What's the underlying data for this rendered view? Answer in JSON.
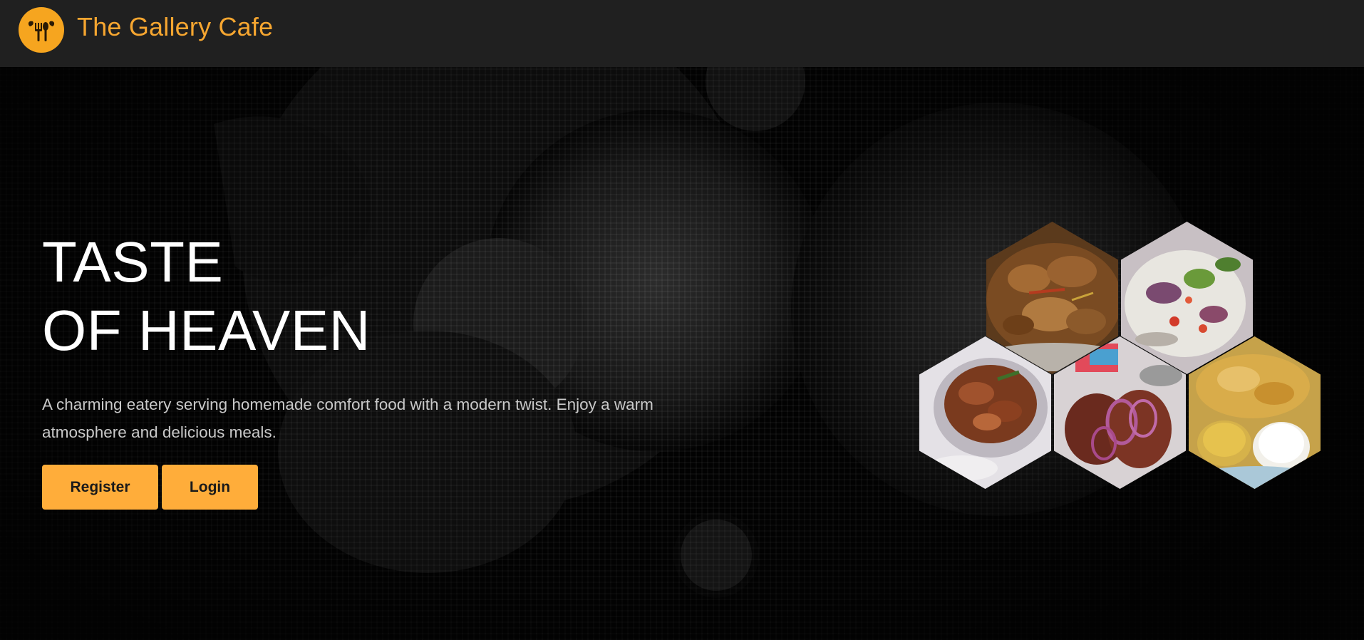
{
  "header": {
    "brand_name": "The Gallery Cafe",
    "logo_icon": "cafe-utensils-logo-icon",
    "accent_color": "#f6a51f"
  },
  "hero": {
    "headline_line1": "TASTE",
    "headline_line2": "OF HEAVEN",
    "description": "A charming eatery serving homemade comfort food with a modern twist. Enjoy a warm atmosphere and delicious meals.",
    "register_label": "Register",
    "login_label": "Login",
    "button_color": "#ffad3a"
  },
  "gallery": {
    "images": [
      {
        "name": "chicken-stew-photo"
      },
      {
        "name": "salad-photo"
      },
      {
        "name": "meat-pot-photo"
      },
      {
        "name": "grilled-meat-onions-photo"
      },
      {
        "name": "omelette-rice-photo"
      }
    ]
  }
}
